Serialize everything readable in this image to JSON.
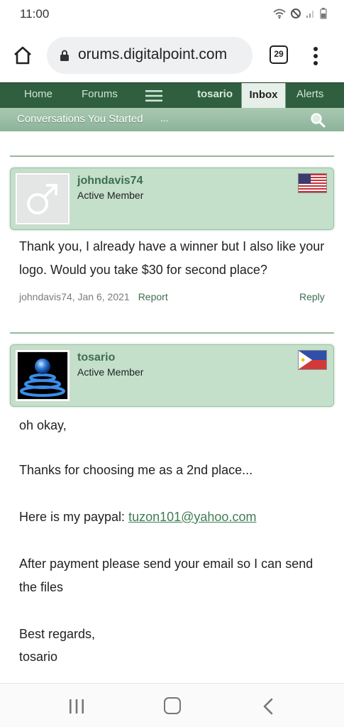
{
  "status": {
    "time": "11:00"
  },
  "browser": {
    "url": "orums.digitalpoint.com",
    "tab_count": "29"
  },
  "nav": {
    "home": "Home",
    "forums": "Forums",
    "user": "tosario",
    "inbox": "Inbox",
    "alerts": "Alerts"
  },
  "subnav": {
    "title": "Conversations You Started",
    "more": "..."
  },
  "messages": [
    {
      "username": "johndavis74",
      "user_title": "Active Member",
      "flag": "united-states-flag",
      "body": "Thank you, I already have a winner but I also like your logo. Would you take $30 for second place?",
      "meta": "johndavis74, Jan 6, 2021",
      "report": "Report",
      "reply": "Reply"
    },
    {
      "username": "tosario",
      "user_title": "Active Member",
      "flag": "philippines-flag",
      "line1": "oh okay,",
      "line2": "Thanks for choosing me as a 2nd place...",
      "line3_prefix": "Here is my paypal: ",
      "email": "tuzon101@yahoo.com",
      "line4": "After payment please send your email so I can send the files",
      "line5": "Best regards,",
      "line6": "tosario"
    }
  ],
  "colors": {
    "nav_bg": "#2f5f3f",
    "card_bg": "#c4dfca",
    "link": "#3f6e4e"
  }
}
